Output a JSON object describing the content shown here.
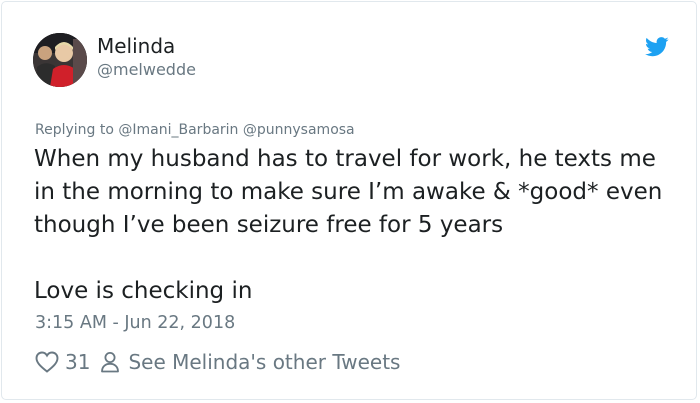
{
  "tweet": {
    "author_name": "Melinda",
    "author_handle": "@melwedde",
    "replying_to_prefix": "Replying to",
    "replying_to": [
      "@Imani_Barbarin",
      "@punnysamosa"
    ],
    "text": "When my husband has to travel for work, he texts me in the morning to make sure I’m awake & *good* even though I’ve been seizure free for 5 years\n\nLove is checking in",
    "timestamp": "3:15 AM - Jun 22, 2018",
    "like_count": "31",
    "other_tweets_label": "See Melinda's other Tweets"
  },
  "icons": {
    "brand": "twitter-bird-icon",
    "like": "heart-icon",
    "profile": "person-icon"
  },
  "colors": {
    "brand_blue": "#1da1f2",
    "text_primary": "#1c2022",
    "text_secondary": "#697882",
    "border": "#e1e8ed"
  }
}
